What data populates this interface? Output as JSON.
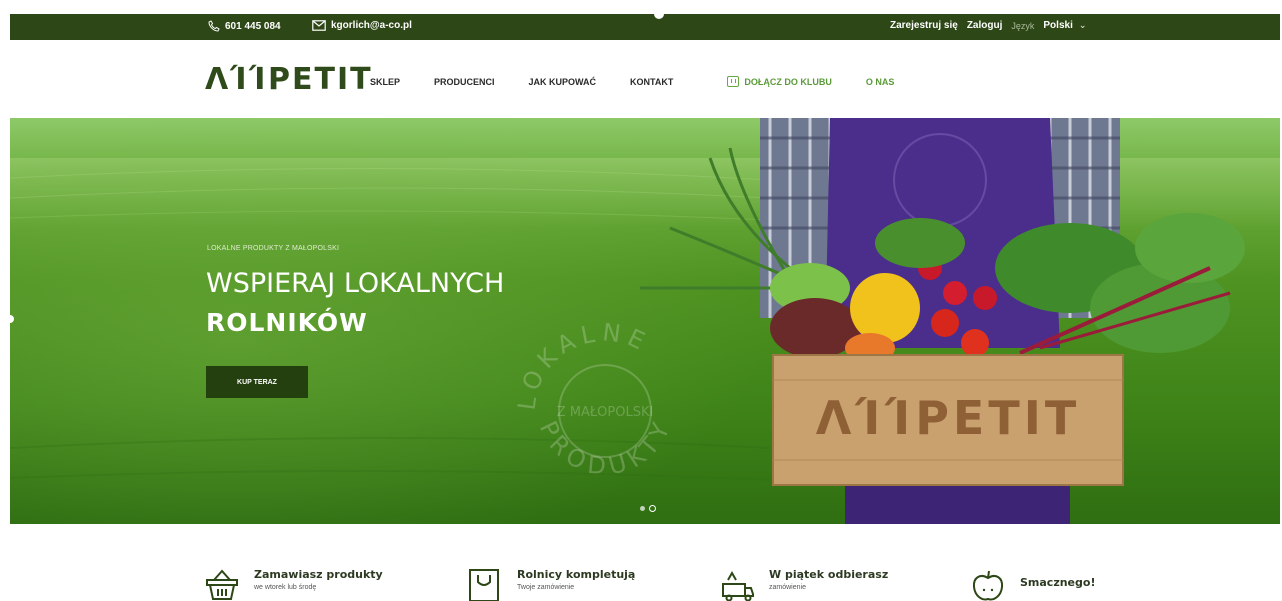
{
  "topbar": {
    "phone": "601 445 084",
    "email": "kgorlich@a-co.pl",
    "register": "Zarejestruj się",
    "login": "Zaloguj",
    "language_label": "Język",
    "language_value": "Polski"
  },
  "nav": {
    "logo": "ΛΊΊPETIT",
    "items": [
      "SKLEP",
      "PRODUCENCI",
      "JAK KUPOWAĆ",
      "KONTAKT"
    ],
    "club": "DOŁĄCZ DO KLUBU",
    "about": "O NAS"
  },
  "hero": {
    "kicker": "LOKALNE PRODUKTY Z MAŁOPOLSKI",
    "heading_line1": "WSPIERAJ LOKALNYCH",
    "heading_line2": "ROLNIKÓW",
    "cta": "KUP TERAZ",
    "seal_top": "LOKALNE",
    "seal_mid": "Z MAŁOPOLSKI",
    "seal_bottom": "PRODUKTY",
    "crate_logo": "ΛΊΊPETIT",
    "slides": 2,
    "active_slide": 2
  },
  "steps": [
    {
      "title": "Zamawiasz produkty",
      "sub": "we wtorek lub środę",
      "icon": "basket-icon"
    },
    {
      "title": "Rolnicy kompletują",
      "sub": "Twoje zamówienie",
      "icon": "bag-icon"
    },
    {
      "title": "W piątek odbierasz",
      "sub": "zamówienie",
      "icon": "delivery-icon"
    },
    {
      "title": "Smacznego!",
      "sub": "",
      "icon": "apple-icon"
    }
  ],
  "colors": {
    "topbar": "#2d4716",
    "brand_dark": "#2f4a1b",
    "brand_green": "#5b9a3a",
    "cta": "#25400f"
  }
}
